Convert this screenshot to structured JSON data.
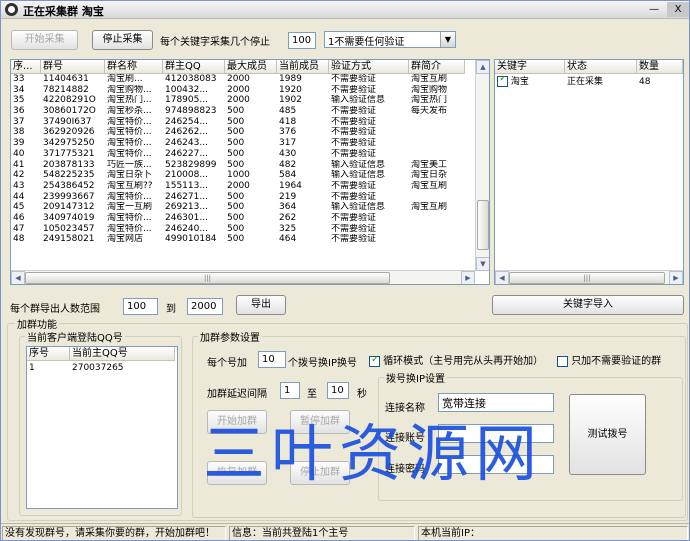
{
  "window": {
    "title": "正在采集群 淘宝",
    "minimize": "—",
    "close": "X"
  },
  "toolbar": {
    "start_label": "开始采集",
    "stop_label": "停止采集",
    "per_keyword_label": "每个关键字采集几个停止",
    "per_keyword_value": "100",
    "verify_select": "1不需要任何验证"
  },
  "group_table": {
    "columns": [
      "序...",
      "群号",
      "群名称",
      "群主QQ",
      "最大成员",
      "当前成员",
      "验证方式",
      "群简介"
    ],
    "rows": [
      [
        "33",
        "11404631",
        "淘宝刷...",
        "412038083",
        "2000",
        "1989",
        "不需要验证",
        "淘宝互刷"
      ],
      [
        "34",
        "78214882",
        "淘宝购物...",
        "100432...",
        "2000",
        "1920",
        "不需要验证",
        "淘宝购物"
      ],
      [
        "35",
        "42208291O",
        "淘宝热门...",
        "178905...",
        "2000",
        "1902",
        "输入验证信息",
        "淘宝热门"
      ],
      [
        "36",
        "30860172O",
        "淘宝秒杀...",
        "974898823",
        "500",
        "485",
        "不需要验证",
        "每天发布"
      ],
      [
        "37",
        "37490I637",
        "淘宝特价...",
        "246254...",
        "500",
        "418",
        "不需要验证",
        ""
      ],
      [
        "38",
        "362920926",
        "淘宝特价...",
        "246262...",
        "500",
        "376",
        "不需要验证",
        ""
      ],
      [
        "39",
        "342975250",
        "淘宝特价...",
        "246243...",
        "500",
        "317",
        "不需要验证",
        ""
      ],
      [
        "40",
        "371775321",
        "淘宝特价...",
        "246227...",
        "500",
        "430",
        "不需要验证",
        ""
      ],
      [
        "41",
        "203878133",
        "巧匠一族...",
        "523829899",
        "500",
        "482",
        "输入验证信息",
        "淘宝美工"
      ],
      [
        "42",
        "548225235",
        "淘宝日杂卜",
        "210008...",
        "1000",
        "584",
        "输入验证信息",
        "淘宝日杂"
      ],
      [
        "43",
        "254386452",
        "淘宝互刷??",
        "155113...",
        "2000",
        "1964",
        "不需要验证",
        "淘宝互刷"
      ],
      [
        "44",
        "239993667",
        "淘宝特价...",
        "246271...",
        "500",
        "219",
        "不需要验证",
        ""
      ],
      [
        "45",
        "209147312",
        "淘宝一互刷",
        "269213...",
        "500",
        "364",
        "输入验证信息",
        "淘宝互刷"
      ],
      [
        "46",
        "340974019",
        "淘宝特价...",
        "246301...",
        "500",
        "262",
        "不需要验证",
        ""
      ],
      [
        "47",
        "105023457",
        "淘宝特价...",
        "246240...",
        "500",
        "325",
        "不需要验证",
        ""
      ],
      [
        "48",
        "249158021",
        "淘宝网店",
        "499010184",
        "500",
        "464",
        "不需要验证",
        ""
      ]
    ]
  },
  "keyword_table": {
    "columns": [
      "关键字",
      "状态",
      "数量"
    ],
    "rows": [
      {
        "keyword": "淘宝",
        "status": "正在采集",
        "count": "48"
      }
    ]
  },
  "export": {
    "range_label": "每个群导出人数范围",
    "from_value": "100",
    "to_label": "到",
    "to_value": "2000",
    "export_label": "导出",
    "import_label": "关键字导入"
  },
  "add_group": {
    "title": "加群功能",
    "client_group_title": "当前客户端登陆QQ号",
    "client_columns": [
      "序号",
      "当前主QQ号"
    ],
    "client_rows": [
      [
        "1",
        "270037265"
      ]
    ],
    "params_title": "加群参数设置",
    "per_qq_label": "每个号加",
    "per_qq_value": "10",
    "per_qq_suffix": "个拨号换IP换号",
    "loop_label": "循环模式（主号用完从头再开始加）",
    "only_no_verify_label": "只加不需要验证的群",
    "delay_label": "加群延迟间隔",
    "delay_from": "1",
    "delay_to_label": "至",
    "delay_to": "10",
    "delay_unit": "秒",
    "start_label": "开始加群",
    "pause_label": "暂停加群",
    "resume_label": "恢复加群",
    "stop_label": "停止加群",
    "dial_title": "拨号换IP设置",
    "conn_name_label": "连接名称",
    "conn_name_value": "宽带连接",
    "conn_account_label": "连接账号",
    "conn_password_label": "连接密码",
    "test_dial_label": "测试拨号"
  },
  "watermark": "三叶资源网",
  "statusbar": {
    "message": "没有发现群号，请采集你要的群，开始加群吧！",
    "info": "信息：当前共登陆1个主号",
    "ip": "本机当前IP："
  }
}
